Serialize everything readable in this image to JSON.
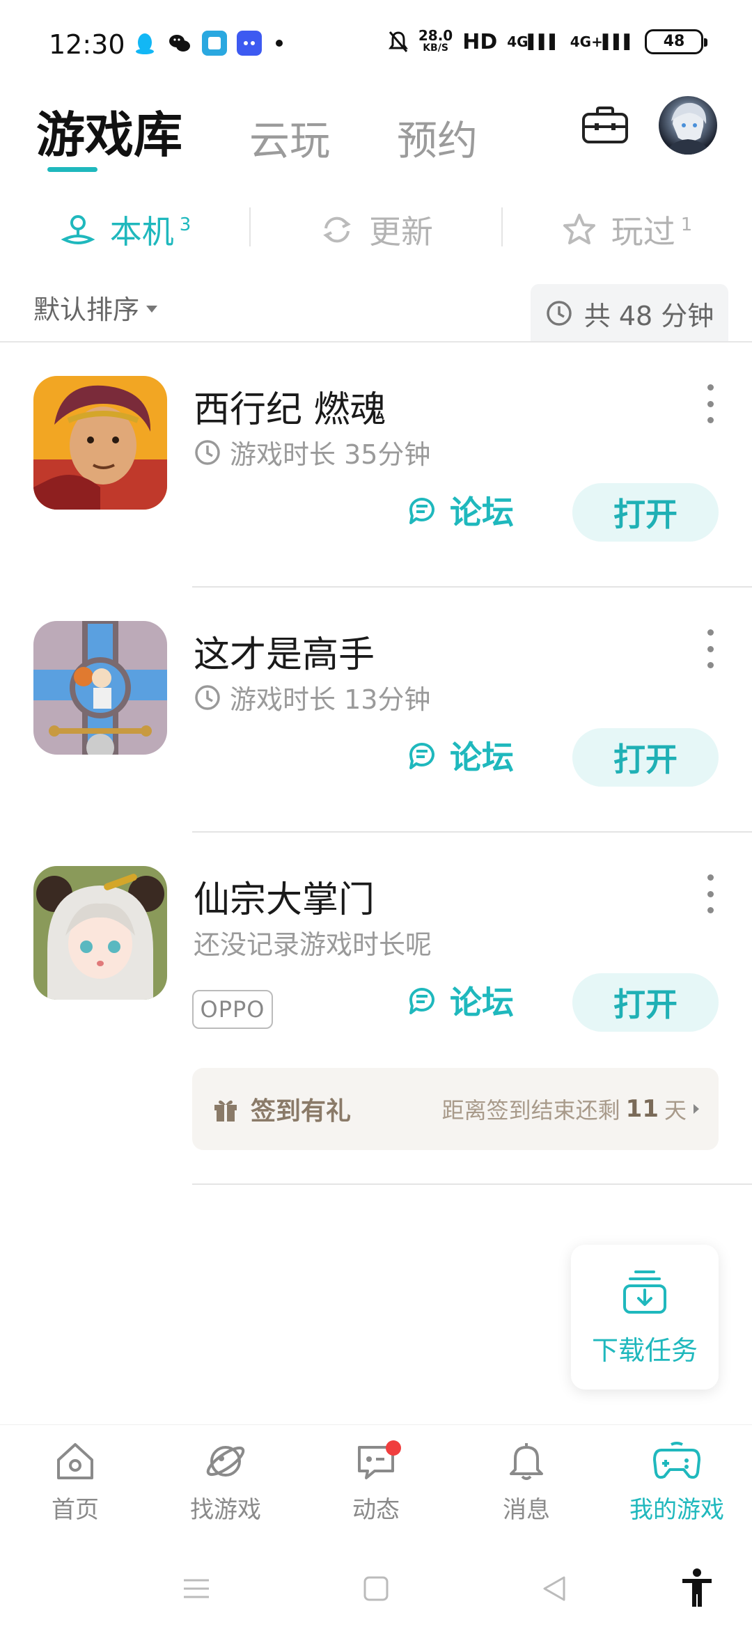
{
  "status_bar": {
    "time": "12:30",
    "speed_value": "28.0",
    "speed_unit": "KB/S",
    "hd": "HD",
    "signal1": "4G",
    "signal2": "4G+",
    "battery": "48"
  },
  "header": {
    "tabs": [
      {
        "label": "游戏库",
        "active": true
      },
      {
        "label": "云玩",
        "active": false
      },
      {
        "label": "预约",
        "active": false
      }
    ]
  },
  "sub_tabs": [
    {
      "label": "本机",
      "count": "3",
      "icon": "device-icon",
      "active": true
    },
    {
      "label": "更新",
      "count": "",
      "icon": "refresh-icon",
      "active": false
    },
    {
      "label": "玩过",
      "count": "1",
      "icon": "star-icon",
      "active": false
    }
  ],
  "sort": {
    "label": "默认排序",
    "total": "共 48 分钟"
  },
  "games": [
    {
      "name": "西行纪 燃魂",
      "time": "游戏时长 35分钟",
      "forum": "论坛",
      "open": "打开"
    },
    {
      "name": "这才是高手",
      "time": "游戏时长 13分钟",
      "forum": "论坛",
      "open": "打开"
    },
    {
      "name": "仙宗大掌门",
      "time": "还没记录游戏时长呢",
      "forum": "论坛",
      "open": "打开",
      "tag": "OPPO"
    }
  ],
  "checkin": {
    "title": "签到有礼",
    "prefix": "距离签到结束还剩",
    "days": "11",
    "suffix": "天"
  },
  "download": {
    "label": "下载任务"
  },
  "bottom_nav": [
    {
      "label": "首页",
      "icon": "home-icon"
    },
    {
      "label": "找游戏",
      "icon": "planet-icon"
    },
    {
      "label": "动态",
      "icon": "chat-icon"
    },
    {
      "label": "消息",
      "icon": "bell-icon"
    },
    {
      "label": "我的游戏",
      "icon": "gamepad-icon",
      "active": true
    }
  ],
  "colors": {
    "accent": "#1fb8bd",
    "accent_bg": "#e6f7f7",
    "badge": "#f03e3e"
  }
}
